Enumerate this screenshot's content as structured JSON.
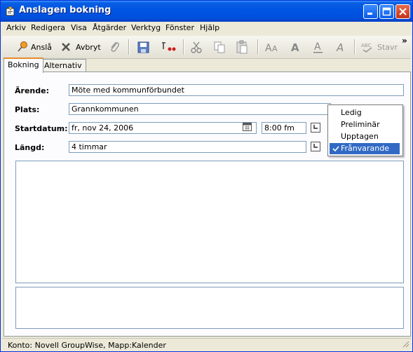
{
  "window": {
    "title": "Anslagen bokning"
  },
  "menu": {
    "items": [
      {
        "label": "Arkiv"
      },
      {
        "label": "Redigera"
      },
      {
        "label": "Visa"
      },
      {
        "label": "Åtgärder"
      },
      {
        "label": "Verktyg"
      },
      {
        "label": "Fönster"
      },
      {
        "label": "Hjälp"
      }
    ]
  },
  "toolbar": {
    "post_label": "Anslå",
    "cancel_label": "Avbryt",
    "spell_label": "Stavr",
    "overflow": "»"
  },
  "tabs": [
    {
      "label": "Bokning",
      "active": true
    },
    {
      "label": "Alternativ",
      "active": false
    }
  ],
  "form": {
    "subject_label": "Ärende:",
    "subject_value": "Möte med kommunförbundet",
    "place_label": "Plats:",
    "place_value": "Grannkommunen",
    "start_label": "Startdatum:",
    "start_date": "fr, nov 24, 2006",
    "start_time": "8:00 fm",
    "length_label": "Längd:",
    "length_value": "4 timmar"
  },
  "show_as_menu": {
    "options": [
      {
        "label": "Ledig",
        "selected": false
      },
      {
        "label": "Preliminär",
        "selected": false
      },
      {
        "label": "Upptagen",
        "selected": false
      },
      {
        "label": "Frånvarande",
        "selected": true
      }
    ]
  },
  "status": {
    "text": "Konto: Novell GroupWise,  Mapp:Kalender"
  },
  "colors": {
    "titlebar": "#0054e3",
    "selection": "#316ac5",
    "tab_accent": "#e68b2c",
    "field_border": "#7f9db9"
  }
}
